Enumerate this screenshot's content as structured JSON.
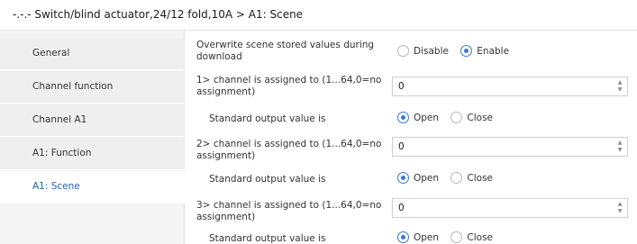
{
  "window": {
    "title": "-.-.- Switch/blind actuator,24/12 fold,10A > A1: Scene"
  },
  "sidebar": {
    "items": [
      {
        "label": "General"
      },
      {
        "label": "Channel function"
      },
      {
        "label": "Channel A1"
      },
      {
        "label": "A1: Function"
      },
      {
        "label": "A1: Scene"
      }
    ]
  },
  "params": {
    "overwrite": {
      "label_line1": "Overwrite scene stored values during",
      "label_line2": "download",
      "options": [
        "Disable",
        "Enable"
      ],
      "selected": "Enable"
    },
    "scene1": {
      "label_line1": "1> channel is assigned to (1...64,0=no",
      "label_line2": "assignment)",
      "value": "0",
      "output_label": "Standard output value is",
      "options": [
        "Open",
        "Close"
      ],
      "selected": "Open"
    },
    "scene2": {
      "label_line1": "2> channel is assigned to (1...64,0=no",
      "label_line2": "assignment)",
      "value": "0",
      "output_label": "Standard output value is",
      "options": [
        "Open",
        "Close"
      ],
      "selected": "Open"
    },
    "scene3": {
      "label_line1": "3> channel is assigned to (1...64,0=no",
      "label_line2": "assignment)",
      "value": "0",
      "output_label": "Standard output value is",
      "options": [
        "Open",
        "Close"
      ],
      "selected": "Open"
    }
  },
  "icons": {
    "spin_up": "chevron-up-icon",
    "spin_down": "chevron-down-icon"
  },
  "colors": {
    "accent": "#3a78c9",
    "active_sidebar_text": "#2a5ea8",
    "sidebar_bg": "#efefef"
  }
}
